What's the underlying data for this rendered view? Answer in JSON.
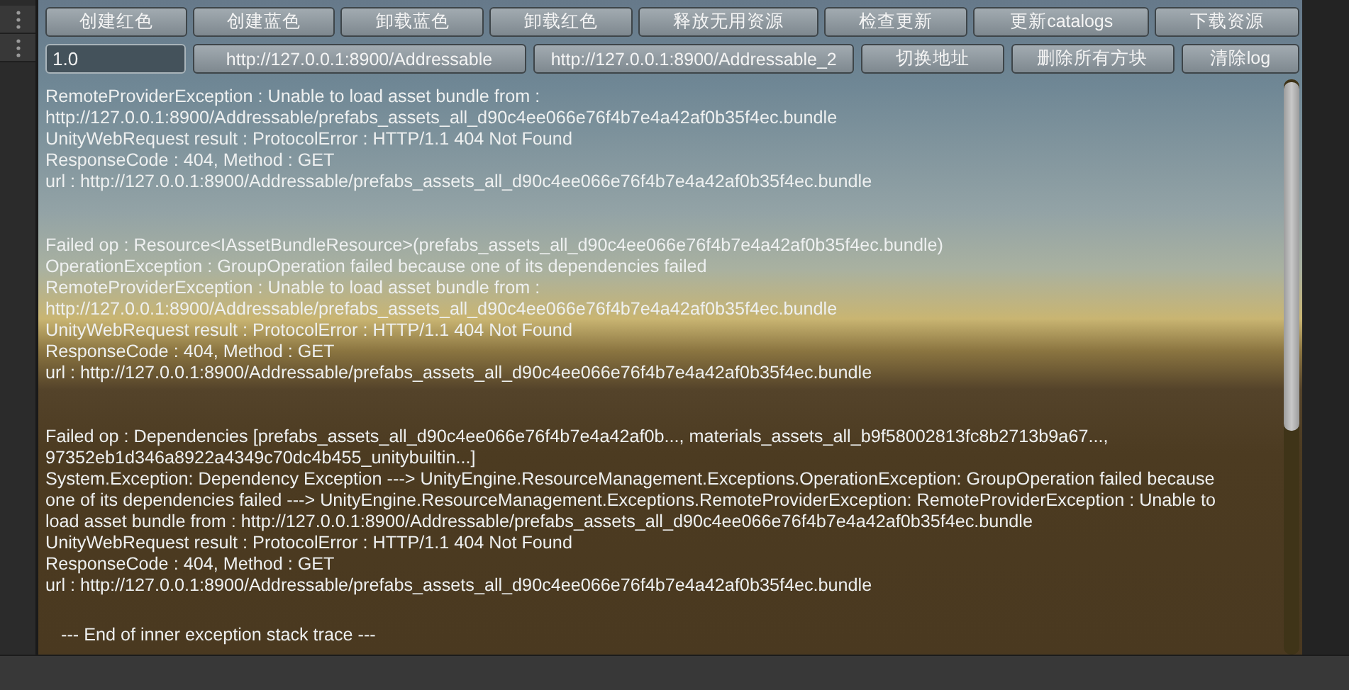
{
  "toolbar_row_1": [
    {
      "label": "创建红色"
    },
    {
      "label": "创建蓝色"
    },
    {
      "label": "卸载蓝色"
    },
    {
      "label": "卸载红色"
    },
    {
      "label": "释放无用资源"
    },
    {
      "label": "检查更新"
    },
    {
      "label": "更新catalogs"
    },
    {
      "label": "下载资源"
    }
  ],
  "version_field": {
    "value": "1.0"
  },
  "toolbar_row_2": [
    {
      "label": "http://127.0.0.1:8900/Addressable"
    },
    {
      "label": "http://127.0.0.1:8900/Addressable_2"
    },
    {
      "label": "切换地址"
    },
    {
      "label": "删除所有方块"
    },
    {
      "label": "清除log"
    }
  ],
  "log": [
    {
      "kind": "message",
      "lines": [
        "RemoteProviderException : Unable to load asset bundle from :",
        "http://127.0.0.1:8900/Addressable/prefabs_assets_all_d90c4ee066e76f4b7e4a42af0b35f4ec.bundle",
        "UnityWebRequest result : ProtocolError : HTTP/1.1 404 Not Found",
        "ResponseCode : 404, Method : GET",
        "url : http://127.0.0.1:8900/Addressable/prefabs_assets_all_d90c4ee066e76f4b7e4a42af0b35f4ec.bundle"
      ]
    },
    {
      "kind": "message",
      "lines": [
        "Failed op : Resource<IAssetBundleResource>(prefabs_assets_all_d90c4ee066e76f4b7e4a42af0b35f4ec.bundle)",
        "OperationException : GroupOperation failed because one of its dependencies failed",
        "RemoteProviderException : Unable to load asset bundle from :",
        "http://127.0.0.1:8900/Addressable/prefabs_assets_all_d90c4ee066e76f4b7e4a42af0b35f4ec.bundle",
        "UnityWebRequest result : ProtocolError : HTTP/1.1 404 Not Found",
        "ResponseCode : 404, Method : GET",
        "url : http://127.0.0.1:8900/Addressable/prefabs_assets_all_d90c4ee066e76f4b7e4a42af0b35f4ec.bundle"
      ]
    },
    {
      "kind": "message",
      "lines": [
        "Failed op : Dependencies [prefabs_assets_all_d90c4ee066e76f4b7e4a42af0b..., materials_assets_all_b9f58002813fc8b2713b9a67...,",
        "97352eb1d346a8922a4349c70dc4b455_unitybuiltin...]",
        "System.Exception: Dependency Exception ---> UnityEngine.ResourceManagement.Exceptions.OperationException: GroupOperation failed because",
        "one of its dependencies failed ---> UnityEngine.ResourceManagement.Exceptions.RemoteProviderException: RemoteProviderException : Unable to",
        "load asset bundle from : http://127.0.0.1:8900/Addressable/prefabs_assets_all_d90c4ee066e76f4b7e4a42af0b35f4ec.bundle",
        "UnityWebRequest result : ProtocolError : HTTP/1.1 404 Not Found",
        "ResponseCode : 404, Method : GET",
        "url : http://127.0.0.1:8900/Addressable/prefabs_assets_all_d90c4ee066e76f4b7e4a42af0b35f4ec.bundle"
      ]
    },
    {
      "kind": "trace",
      "lines": [
        "--- End of inner exception stack trace ---"
      ]
    }
  ]
}
